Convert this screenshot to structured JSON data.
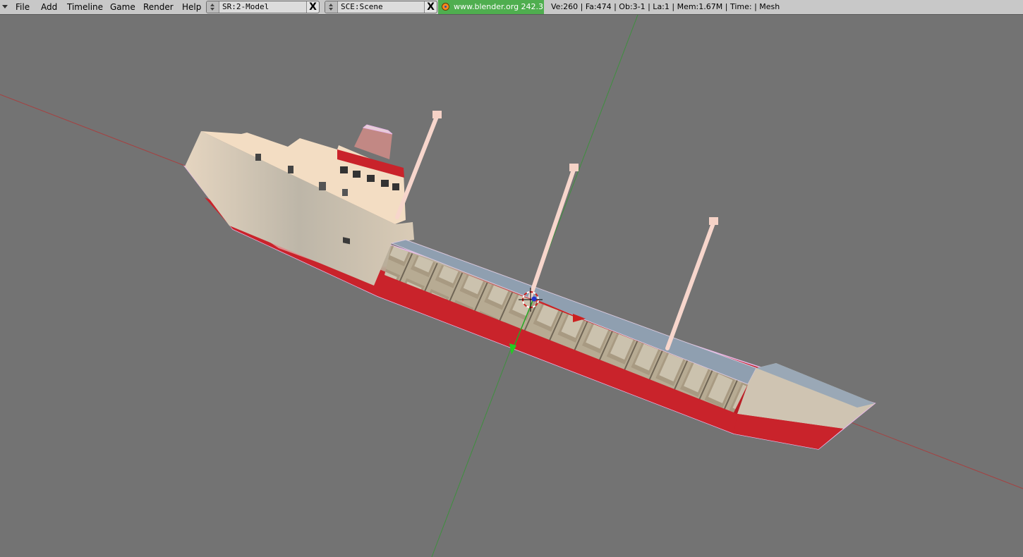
{
  "menu": {
    "file": "File",
    "add": "Add",
    "timeline": "Timeline",
    "game": "Game",
    "render": "Render",
    "help": "Help"
  },
  "screen_selector": {
    "value": "SR:2-Model",
    "delete_label": "X"
  },
  "scene_selector": {
    "value": "SCE:Scene",
    "delete_label": "X"
  },
  "version_box": {
    "text": "www.blender.org 242.3"
  },
  "stats": {
    "text": "Ve:260 | Fa:474 | Ob:3-1 | La:1  | Mem:1.67M  | Time: | Mesh"
  },
  "colors": {
    "header_bg": "#c8c8c8",
    "viewport_bg": "#737373",
    "x_axis": "#a54141",
    "y_axis": "#3f8f3f",
    "hull_red": "#c9232b",
    "cream": "#f3ddc3",
    "deck_gray": "#8f9fb0"
  }
}
